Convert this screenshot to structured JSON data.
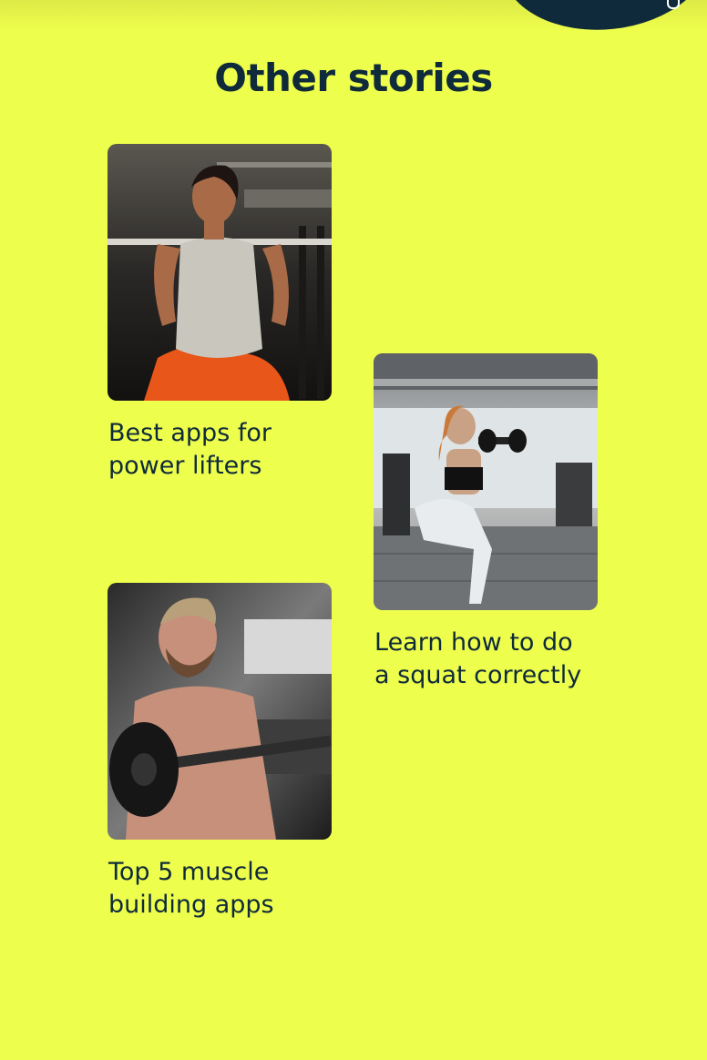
{
  "section": {
    "title": "Other stories"
  },
  "stories": [
    {
      "title": "Best apps for power lifters",
      "image": "woman-barbell-squat-photo"
    },
    {
      "title": "Learn how to do a squat correctly",
      "image": "woman-dumbbell-squat-photo"
    },
    {
      "title": "Top 5 muscle building apps",
      "image": "man-barbell-curl-photo"
    }
  ],
  "colors": {
    "background": "#eefe4c",
    "text": "#0f2a3a",
    "accent": "#0f2a3a"
  }
}
